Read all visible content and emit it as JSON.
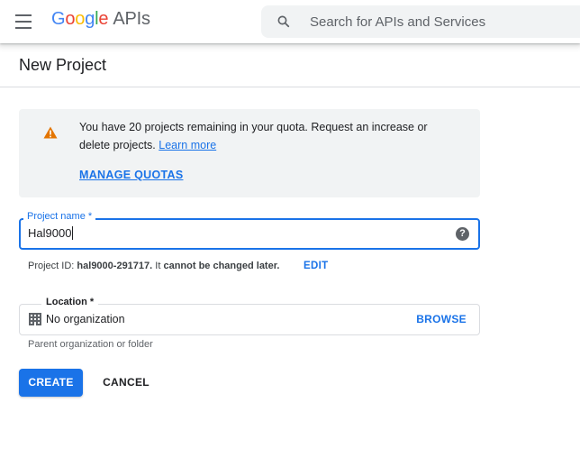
{
  "header": {
    "logo_letters": [
      "G",
      "o",
      "o",
      "g",
      "l",
      "e"
    ],
    "logo_suffix": "APIs",
    "search_placeholder": "Search for APIs and Services"
  },
  "page": {
    "title": "New Project"
  },
  "quota_notice": {
    "text": "You have 20 projects remaining in your quota. Request an increase or delete projects.",
    "link": "Learn more",
    "action": "MANAGE QUOTAS"
  },
  "project_name": {
    "label": "Project name *",
    "value": "Hal9000"
  },
  "project_id": {
    "prefix": "Project ID:",
    "id": "hal9000-291717.",
    "middle": "It",
    "bold_note": "cannot be changed later.",
    "edit_label": "EDIT"
  },
  "location": {
    "label": "Location *",
    "value": "No organization",
    "browse_label": "BROWSE",
    "helper": "Parent organization or folder"
  },
  "actions": {
    "create": "CREATE",
    "cancel": "CANCEL"
  },
  "colors": {
    "accent": "#1a73e8",
    "warning": "#e37400",
    "notice_bg": "#f1f3f4"
  }
}
